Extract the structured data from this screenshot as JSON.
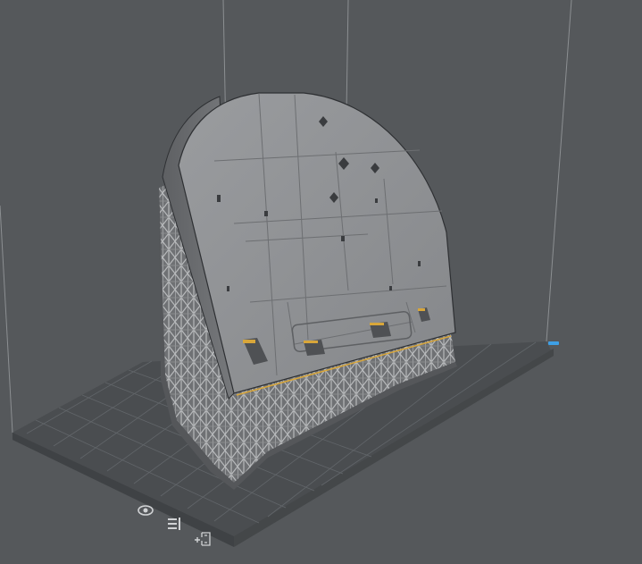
{
  "app": {
    "view": "3d-print-preview"
  },
  "colors": {
    "background": "#55585b",
    "build_plate": "#4a4d50",
    "grid_line": "#6a6d70",
    "frame_line": "#8c8f92",
    "model_face": "#8f9194",
    "model_edge": "#2e3033",
    "support": "#9a9c9e",
    "axis_accent": "#3ea0e6",
    "label_accent": "#d8a63a"
  },
  "overlay_icons": [
    {
      "name": "visibility-eye-icon"
    },
    {
      "name": "layers-list-icon"
    },
    {
      "name": "add-support-icon"
    }
  ]
}
